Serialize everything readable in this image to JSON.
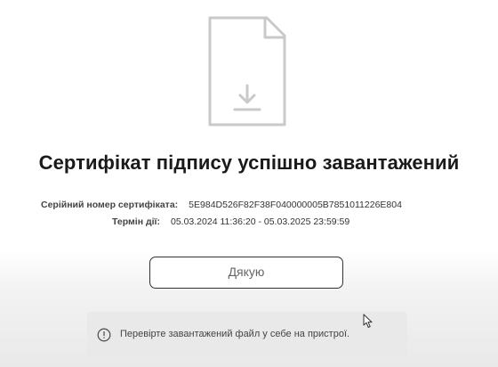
{
  "title": "Сертифікат підпису успішно завантажений",
  "certificate": {
    "serial_label": "Серійний номер сертифіката:",
    "serial_value": "5E984D526F82F38F040000005B7851011226E804",
    "term_label": "Термін дії:",
    "term_value": "05.03.2024 11:36:20 - 05.03.2025 23:59:59"
  },
  "buttons": {
    "ok_label": "Дякую"
  },
  "notice": {
    "text": "Перевірте завантажений файл у себе на пристрої."
  },
  "icons": {
    "document": "document-download-icon",
    "notice": "info-circle-icon",
    "cursor": "mouse-cursor-icon"
  },
  "colors": {
    "title": "#1a1a1a",
    "button_border": "#333333",
    "notice_bg": "#e9e9e9"
  }
}
